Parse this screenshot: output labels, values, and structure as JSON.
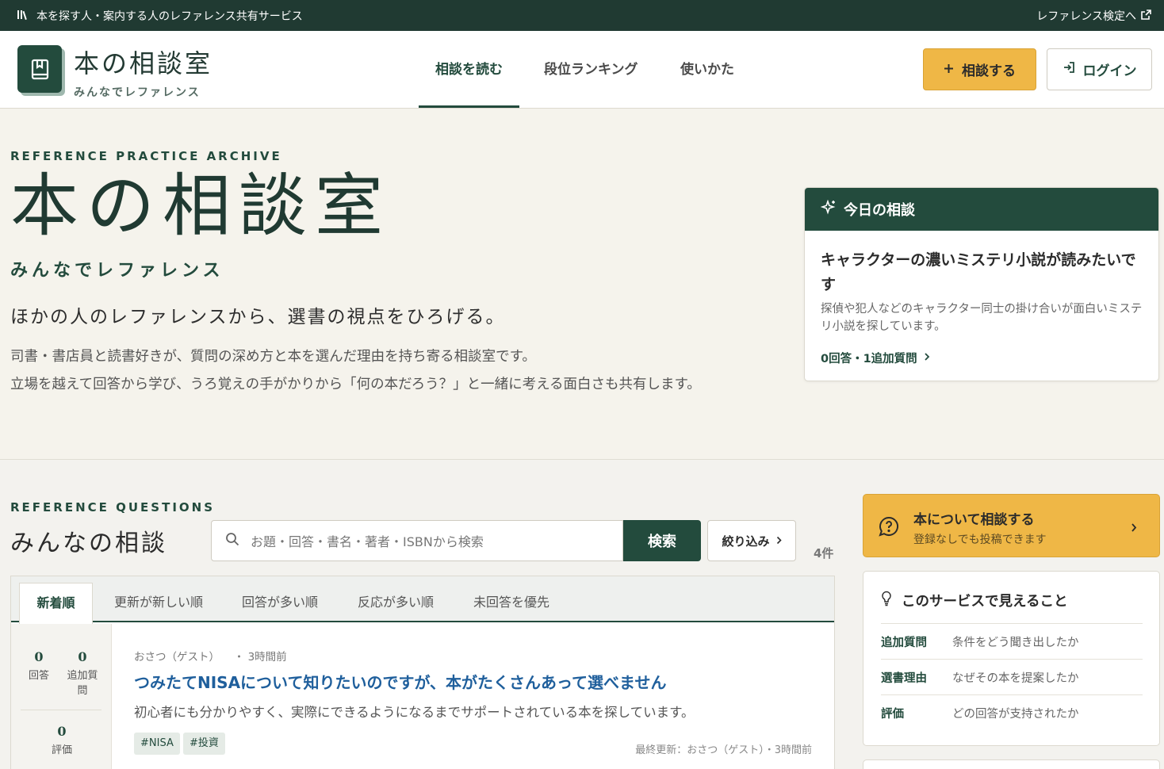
{
  "topbar": {
    "tagline": "本を探す人・案内する人のレファレンス共有サービス",
    "exam_link": "レファレンス検定へ"
  },
  "header": {
    "title": "本の相談室",
    "subtitle": "みんなでレファレンス",
    "nav": [
      {
        "label": "相談を読む",
        "active": true
      },
      {
        "label": "段位ランキング",
        "active": false
      },
      {
        "label": "使いかた",
        "active": false
      }
    ],
    "consult_button": "相談する",
    "login_button": "ログイン"
  },
  "hero": {
    "eyebrow": "REFERENCE PRACTICE ARCHIVE",
    "title": "本の相談室",
    "subtitle": "みんなでレファレンス",
    "lead": "ほかの人のレファレンスから、選書の視点をひろげる。",
    "desc_line1": "司書・書店員と読書好きが、質問の深め方と本を選んだ理由を持ち寄る相談室です。",
    "desc_line2": "立場を越えて回答から学び、うろ覚えの手がかりから「何の本だろう？」と一緒に考える面白さも共有します。"
  },
  "today": {
    "heading": "今日の相談",
    "question": "キャラクターの濃いミステリ小説が読みたいです",
    "desc": "探偵や犯人などのキャラクター同士の掛け合いが面白いミステリ小説を探しています。",
    "meta": "0回答・1追加質問"
  },
  "questions": {
    "eyebrow": "REFERENCE QUESTIONS",
    "title": "みんなの相談",
    "search_placeholder": "お題・回答・書名・著者・ISBNから検索",
    "search_button": "検索",
    "filter_button": "絞り込み",
    "count": "4件",
    "tabs": [
      "新着順",
      "更新が新しい順",
      "回答が多い順",
      "反応が多い順",
      "未回答を優先"
    ],
    "items": [
      {
        "answers": "0",
        "answers_label": "回答",
        "followups": "0",
        "followups_label": "追加質問",
        "rating": "0",
        "rating_label": "評価",
        "author": "おさつ（ゲスト）",
        "time": "3時間前",
        "title": "つみたてNISAについて知りたいのですが、本がたくさんあって選べません",
        "desc": "初心者にも分かりやすく、実際にできるようになるまでサポートされている本を探しています。",
        "tags": [
          "#NISA",
          "#投資"
        ],
        "updated": "最終更新：おさつ（ゲスト）・3時間前"
      }
    ]
  },
  "sidebar": {
    "cta_title": "本について相談する",
    "cta_sub": "登録なしでも投稿できます",
    "features_title": "このサービスで見えること",
    "features": [
      {
        "key": "追加質問",
        "value": "条件をどう聞き出したか"
      },
      {
        "key": "選書理由",
        "value": "なぜその本を提案したか"
      },
      {
        "key": "評価",
        "value": "どの回答が支持されたか"
      }
    ]
  },
  "icons": {
    "books": "books-icon",
    "external": "external-link-icon",
    "book_logo": "book-icon",
    "plus": "plus-icon",
    "login": "login-icon",
    "sparkle": "sparkle-icon",
    "search": "search-icon",
    "chat": "chat-question-icon",
    "bulb": "lightbulb-icon",
    "chevron": "chevron-right-icon"
  },
  "colors": {
    "brand_green": "#234b3d",
    "accent_yellow": "#efb746",
    "link_blue": "#1f5f9c"
  }
}
